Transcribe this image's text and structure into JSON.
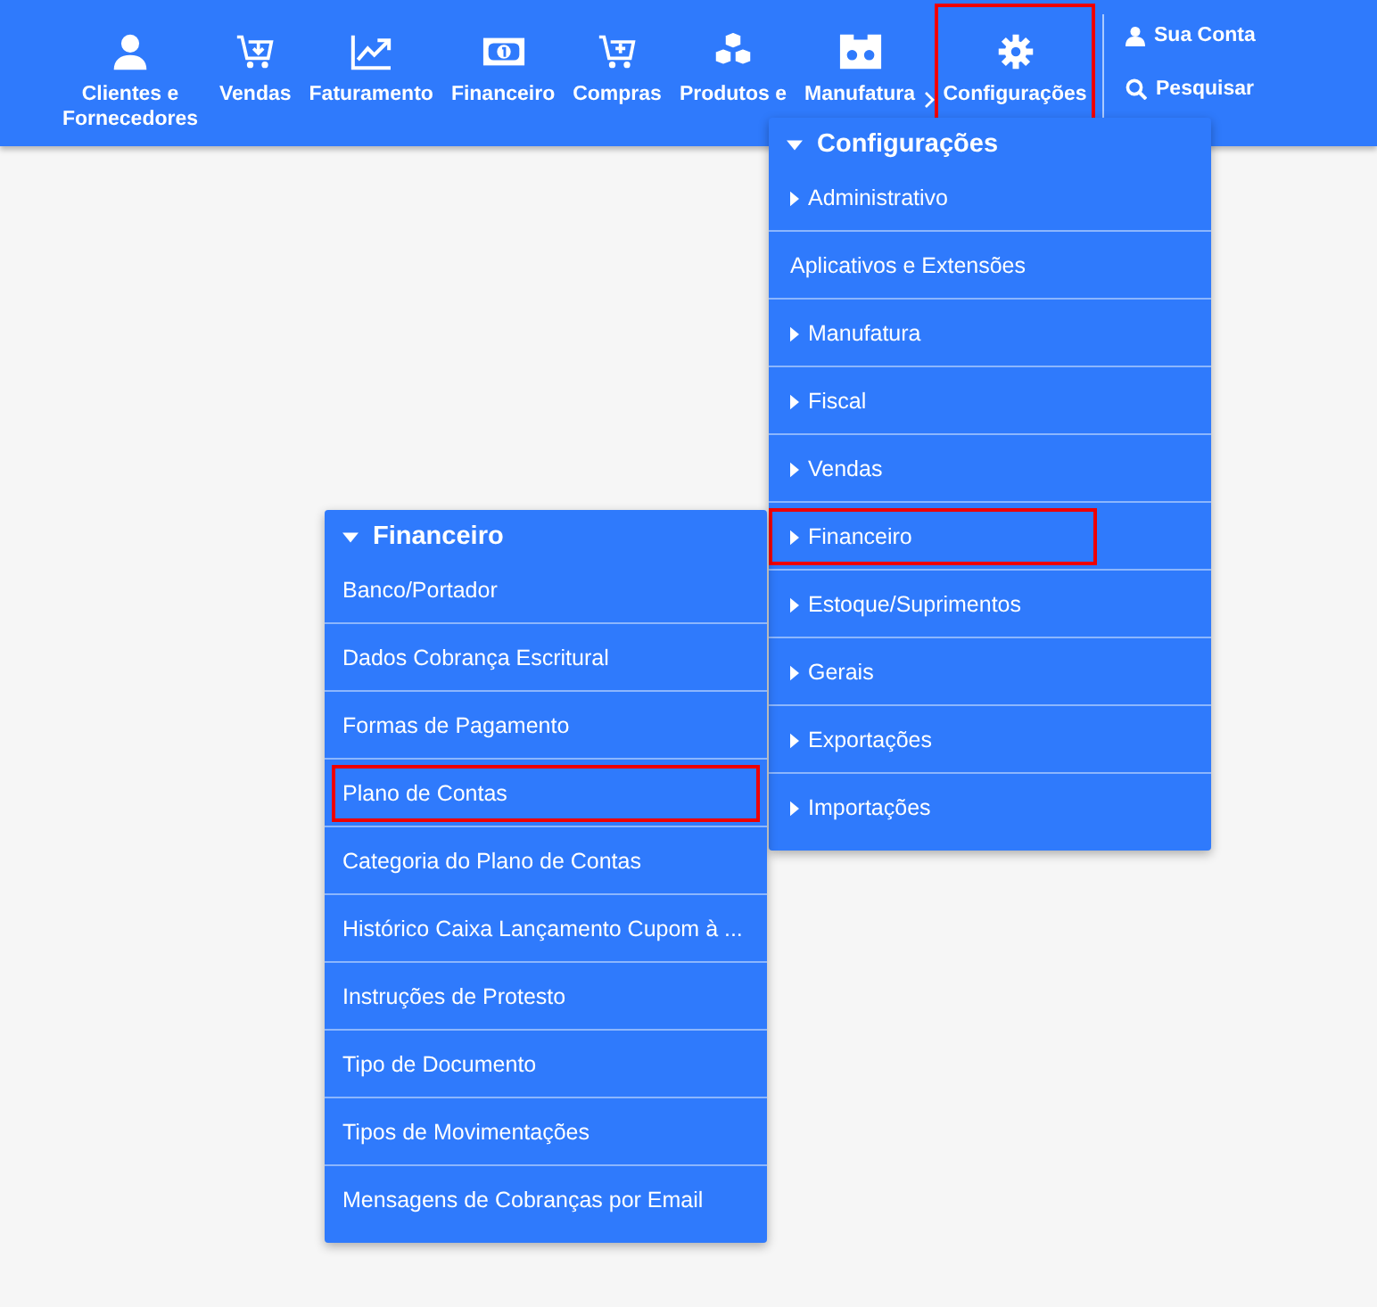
{
  "nav": {
    "items": [
      {
        "label": "Clientes e Fornecedores",
        "kind": "person",
        "selected": false,
        "highlighted": false
      },
      {
        "label": "Vendas",
        "kind": "cart-down",
        "selected": false,
        "highlighted": false
      },
      {
        "label": "Faturamento",
        "kind": "chart",
        "selected": false,
        "highlighted": false
      },
      {
        "label": "Financeiro",
        "kind": "money",
        "selected": false,
        "highlighted": false
      },
      {
        "label": "Compras",
        "kind": "cart-plus",
        "selected": false,
        "highlighted": false
      },
      {
        "label": "Produtos e",
        "kind": "cubes",
        "selected": false,
        "highlighted": false
      },
      {
        "label": "Manufatura",
        "kind": "reel",
        "selected": false,
        "highlighted": false
      },
      {
        "label": "Configurações",
        "kind": "gear",
        "selected": true,
        "highlighted": true
      }
    ],
    "account": "Sua Conta",
    "search": "Pesquisar"
  },
  "menu": {
    "title": "Configurações",
    "expanded": true,
    "items": [
      {
        "label": "Administrativo",
        "has_children": true,
        "highlighted": false
      },
      {
        "label": "Aplicativos e Extensões",
        "has_children": false,
        "highlighted": false
      },
      {
        "label": "Manufatura",
        "has_children": true,
        "highlighted": false
      },
      {
        "label": "Fiscal",
        "has_children": true,
        "highlighted": false
      },
      {
        "label": "Vendas",
        "has_children": true,
        "highlighted": false
      },
      {
        "label": "Financeiro",
        "has_children": true,
        "highlighted": true
      },
      {
        "label": "Estoque/Suprimentos",
        "has_children": true,
        "highlighted": false
      },
      {
        "label": "Gerais",
        "has_children": true,
        "highlighted": false
      },
      {
        "label": "Exportações",
        "has_children": true,
        "highlighted": false
      },
      {
        "label": "Importações",
        "has_children": true,
        "highlighted": false
      }
    ]
  },
  "submenu": {
    "title": "Financeiro",
    "expanded": true,
    "items": [
      {
        "label": "Banco/Portador",
        "highlighted": false
      },
      {
        "label": "Dados Cobrança Escritural",
        "highlighted": false
      },
      {
        "label": "Formas de Pagamento",
        "highlighted": false
      },
      {
        "label": "Plano de Contas",
        "highlighted": true
      },
      {
        "label": "Categoria do Plano de Contas",
        "highlighted": false
      },
      {
        "label": "Histórico Caixa Lançamento Cupom à ...",
        "highlighted": false
      },
      {
        "label": "Instruções de Protesto",
        "highlighted": false
      },
      {
        "label": "Tipo de Documento",
        "highlighted": false
      },
      {
        "label": "Tipos de Movimentações",
        "highlighted": false
      },
      {
        "label": "Mensagens de Cobranças por Email",
        "highlighted": false
      }
    ]
  }
}
